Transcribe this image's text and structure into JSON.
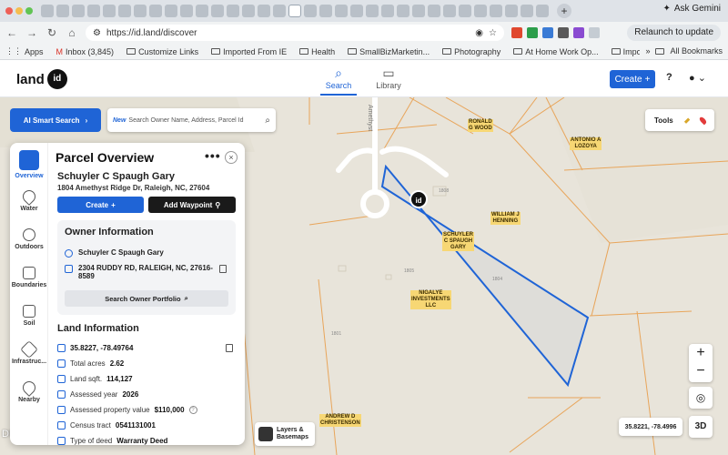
{
  "browser": {
    "gemini_label": "Ask Gemini",
    "url": "https://id.land/discover",
    "relaunch_label": "Relaunch to update",
    "bookmarks": [
      "Apps",
      "Inbox (3,845)",
      "Customize Links",
      "Imported From IE",
      "Health",
      "SmallBizMarketin...",
      "Photography",
      "At Home Work Op...",
      "Imported From IE..."
    ],
    "all_bookmarks": "All Bookmarks"
  },
  "app": {
    "logo_text": "land",
    "logo_badge": "id",
    "nav": [
      {
        "label": "Search",
        "icon": "search-icon"
      },
      {
        "label": "Library",
        "icon": "book-icon"
      }
    ],
    "create_label": "Create",
    "help_label": "?"
  },
  "map": {
    "smart_search_label": "AI Smart Search",
    "search_new": "New",
    "search_placeholder": "Search Owner Name, Address, Parcel Id",
    "tools_label": "Tools",
    "coords": "35.8221, -78.4996",
    "three_d": "3D",
    "layers_line1": "Layers &",
    "layers_line2": "Basemaps",
    "watermark": "DMLS",
    "road_label": "Amethyst",
    "owner_labels": [
      {
        "l1": "RONALD",
        "l2": "G WOOD",
        "l3": ""
      },
      {
        "l1": "ANTONIO A",
        "l2": "LOZOYA",
        "l3": ""
      },
      {
        "l1": "WILLIAM J",
        "l2": "HENNING",
        "l3": ""
      },
      {
        "l1": "SCHUYLER",
        "l2": "C SPAUGH",
        "l3": "GARY"
      },
      {
        "l1": "NIGALYE",
        "l2": "INVESTMENTS",
        "l3": "LLC"
      },
      {
        "l1": "ANDREW D",
        "l2": "CHRISTENSON",
        "l3": ""
      }
    ]
  },
  "panel": {
    "title": "Parcel Overview",
    "owner_name": "Schuyler C Spaugh Gary",
    "address": "1804 Amethyst Ridge Dr, Raleigh, NC, 27604",
    "create_label": "Create",
    "waypoint_label": "Add Waypoint",
    "owner_info_title": "Owner Information",
    "owner_row": "Schuyler C Spaugh Gary",
    "mailing_line1": "2304 RUDDY RD, RALEIGH, NC, 27616-",
    "mailing_line2": "8589",
    "portfolio_label": "Search Owner Portfolio",
    "land_info_title": "Land Information",
    "land": {
      "coords": "35.8227, -78.49764",
      "acres_label": "Total acres",
      "acres_value": "2.62",
      "sqft_label": "Land sqft.",
      "sqft_value": "114,127",
      "year_label": "Assessed year",
      "year_value": "2026",
      "value_label": "Assessed property value",
      "value_value": "$110,000",
      "tract_label": "Census tract",
      "tract_value": "0541131001",
      "deed_label": "Type of deed",
      "deed_value": "Warranty Deed"
    },
    "rail": [
      "Overview",
      "Water",
      "Outdoors",
      "Boundaries",
      "Soil",
      "Infrastruc...",
      "Nearby"
    ]
  }
}
